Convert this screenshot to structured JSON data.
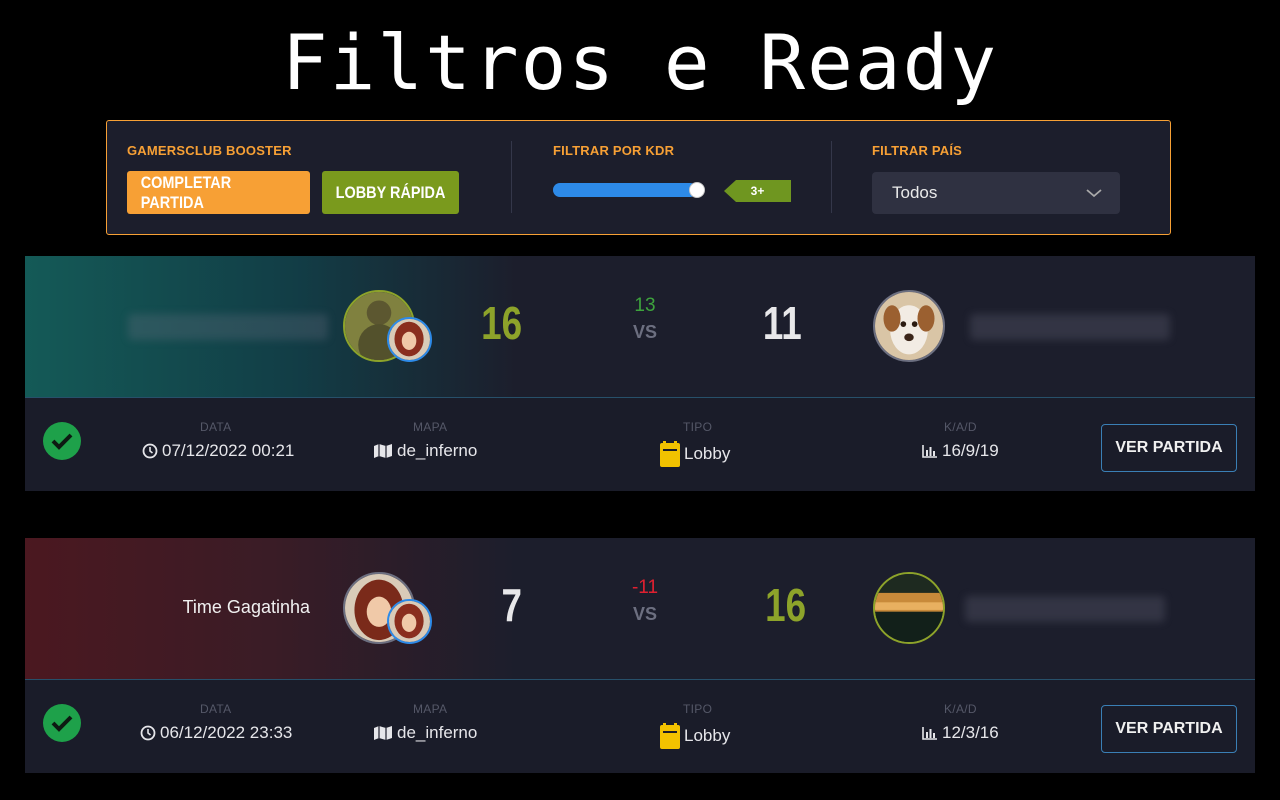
{
  "headline": "Filtros e Ready",
  "filters": {
    "booster_label": "GAMERSCLUB BOOSTER",
    "complete_button": "COMPLETAR PARTIDA",
    "lobby_button": "LOBBY RÁPIDA",
    "kdr_label": "FILTRAR POR KDR",
    "kdr_value": "3+",
    "kdr_slider_fraction": 1.0,
    "country_label": "FILTRAR PAÍS",
    "country_selected": "Todos"
  },
  "columns": {
    "date": "DATA",
    "map": "MAPA",
    "type": "TIPO",
    "kad": "K/A/D"
  },
  "matches": [
    {
      "result": "win",
      "team_left": "",
      "score_left": "16",
      "diff": "13",
      "vs": "VS",
      "score_right": "11",
      "team_right": "",
      "date": "07/12/2022 00:21",
      "map": "de_inferno",
      "type": "Lobby",
      "kad": "16/9/19",
      "view_button": "VER PARTIDA"
    },
    {
      "result": "loss",
      "team_left": "Time Gagatinha",
      "score_left": "7",
      "diff": "-11",
      "vs": "VS",
      "score_right": "16",
      "team_right": "",
      "date": "06/12/2022 23:33",
      "map": "de_inferno",
      "type": "Lobby",
      "kad": "12/3/16",
      "view_button": "VER PARTIDA"
    }
  ],
  "colors": {
    "accent_orange": "#f7a035",
    "lobby_green": "#7a9a1d",
    "slider_blue": "#2d8ae8",
    "win_score": "#8da32a",
    "diff_positive": "#3da33d",
    "diff_negative": "#e02030"
  },
  "icons": [
    "clock-icon",
    "map-icon",
    "lobby-icon",
    "chart-icon",
    "check-icon",
    "chevron-down-icon"
  ]
}
